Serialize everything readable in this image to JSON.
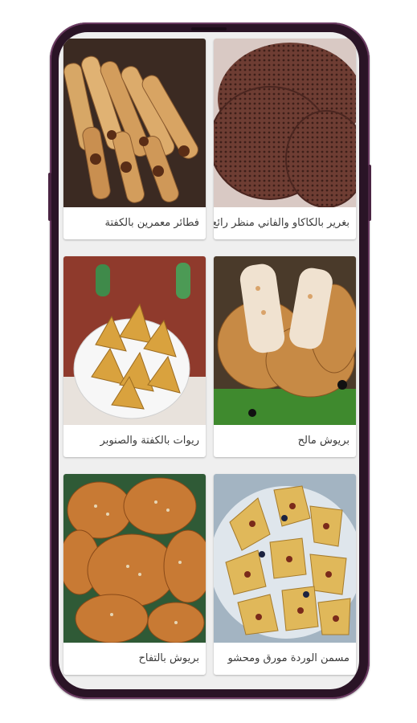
{
  "recipes": [
    {
      "title": "بغرير بالكاكاو والفاني منظر رائع",
      "image": "cocoa-baghrir-photo"
    },
    {
      "title": "فطائر معمرين بالكفتة",
      "image": "kefta-rolls-photo"
    },
    {
      "title": "بريوش مالح",
      "image": "savory-brioche-photo"
    },
    {
      "title": "ريوات بالكفتة والصنوبر",
      "image": "kefta-briouats-photo"
    },
    {
      "title": "مسمن الوردة مورق ومحشو",
      "image": "stuffed-msemen-photo"
    },
    {
      "title": "بريوش بالتفاح",
      "image": "apple-brioche-photo"
    }
  ],
  "colors": {
    "phone_frame": "#2a1426",
    "screen_bg": "#efefef",
    "card_bg": "#ffffff"
  }
}
